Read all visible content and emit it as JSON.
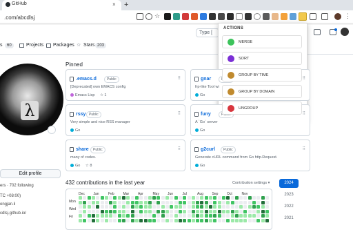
{
  "browser": {
    "tab_title": "GitHub",
    "tab_close": "×",
    "new_tab": "+",
    "url": ".com/abcdlsj"
  },
  "github": {
    "nav": {
      "repos_label": "s",
      "repos_count": "60",
      "projects_label": "Projects",
      "packages_label": "Packages",
      "stars_label": "Stars",
      "stars_count": "203"
    },
    "search_placeholder": "Type [",
    "edit_profile": "Edit profile",
    "followers_line": "ers · 702 following",
    "timezone_line": "TC +08:00)",
    "org_line": "ongjan.li",
    "site_line": "cdlsj.github.io/",
    "pinned_label": "Pinned",
    "pinned": [
      {
        "name": ".emacs.d",
        "badge": "Public",
        "desc": "[Deprecated] own EMACS config",
        "lang": "Emacs Lisp",
        "lang_color": "#c065db",
        "stars": "1"
      },
      {
        "name": "gnar",
        "badge": "Public",
        "desc": "frp-like Tool wi",
        "lang": "Go",
        "lang_color": "#00add8",
        "stars": ""
      },
      {
        "name": "rssy",
        "badge": "Public",
        "desc": "Very simple and nice RSS manager",
        "lang": "Go",
        "lang_color": "#00add8",
        "stars": ""
      },
      {
        "name": "funy",
        "badge": "Public",
        "desc": "A `Go` server",
        "lang": "Go",
        "lang_color": "#00add8",
        "stars": ""
      },
      {
        "name": "share",
        "badge": "Public",
        "desc": "many of codes.",
        "lang": "Go",
        "lang_color": "#00add8",
        "stars": "8"
      },
      {
        "name": "g2curl",
        "badge": "Public",
        "desc": "Generate cURL command from Go http.Request.",
        "lang": "Go",
        "lang_color": "#00add8",
        "stars": ""
      }
    ],
    "contrib_title": "432 contributions in the last year",
    "contrib_settings": "Contribution settings ▾",
    "months": [
      "Dec",
      "Jan",
      "Feb",
      "Mar",
      "Apr",
      "May",
      "Jun",
      "Jul",
      "Aug",
      "Sep",
      "Oct",
      "Nov"
    ],
    "days": [
      "Mon",
      "Wed",
      "Fri"
    ],
    "years": [
      "2024",
      "2023",
      "2022",
      "2021"
    ],
    "selected_year": "2024"
  },
  "popup": {
    "heading": "ACTIONS",
    "actions": [
      {
        "label": "MERGE",
        "color": "#3cc35b"
      },
      {
        "label": "SORT",
        "color": "#7b2fd6"
      },
      {
        "label": "GROUP BY TIME",
        "color": "#c08a2e"
      },
      {
        "label": "GROUP BY DOMAIN",
        "color": "#c08a2e"
      },
      {
        "label": "UNGROUP",
        "color": "#d8363e"
      }
    ]
  },
  "colors": {
    "link": "#0969da",
    "year_active": "#0969da",
    "contrib_levels": [
      "#ebedf0",
      "#9be9a8",
      "#40c463",
      "#30a14e",
      "#216e39"
    ]
  }
}
